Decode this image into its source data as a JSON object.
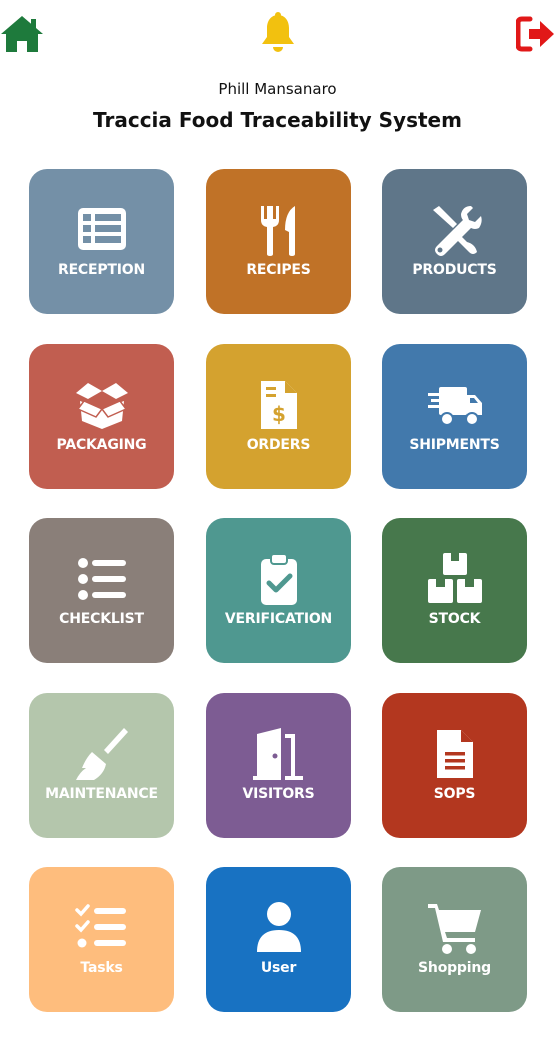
{
  "header": {
    "home_icon": "home-icon",
    "notification_icon": "bell-icon",
    "logout_icon": "logout-icon",
    "user_name": "Phill Mansanaro",
    "app_title": "Traccia Food Traceability System"
  },
  "colors": {
    "home": "#1e7a3c",
    "bell": "#f2c10f",
    "logout": "#e11818"
  },
  "tiles": [
    {
      "label": "RECEPTION",
      "icon": "list-icon",
      "color": "#7490a7"
    },
    {
      "label": "RECIPES",
      "icon": "utensils-icon",
      "color": "#c07227"
    },
    {
      "label": "PRODUCTS",
      "icon": "tools-icon",
      "color": "#5f7689"
    },
    {
      "label": "PACKAGING",
      "icon": "box-open-icon",
      "color": "#c15e50"
    },
    {
      "label": "ORDERS",
      "icon": "invoice-dollar-icon",
      "color": "#d4a22f"
    },
    {
      "label": "SHIPMENTS",
      "icon": "truck-icon",
      "color": "#4279ac"
    },
    {
      "label": "CHECKLIST",
      "icon": "checklist-icon",
      "color": "#8a7f79"
    },
    {
      "label": "VERIFICATION",
      "icon": "clipboard-check-icon",
      "color": "#4f9890"
    },
    {
      "label": "STOCK",
      "icon": "boxes-icon",
      "color": "#47784c"
    },
    {
      "label": "MAINTENANCE",
      "icon": "broom-icon",
      "color": "#b4c6ac"
    },
    {
      "label": "VISITORS",
      "icon": "door-open-icon",
      "color": "#7d5c93"
    },
    {
      "label": "SOPS",
      "icon": "file-alt-icon",
      "color": "#b3371f"
    },
    {
      "label": "Tasks",
      "icon": "tasks-icon",
      "color": "#febd7d"
    },
    {
      "label": "User",
      "icon": "user-icon",
      "color": "#1872c2"
    },
    {
      "label": "Shopping",
      "icon": "shopping-cart-icon",
      "color": "#7e9a87"
    }
  ]
}
